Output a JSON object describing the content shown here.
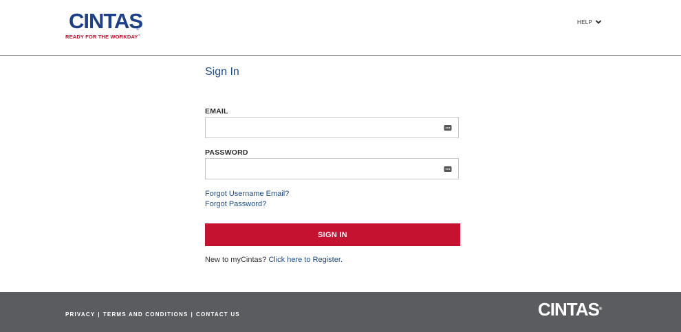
{
  "header": {
    "logo_word": "CINTAS",
    "logo_registered": "®",
    "logo_tagline": "READY FOR THE WORKDAY",
    "logo_tm": "™",
    "help_label": "HELP"
  },
  "main": {
    "title": "Sign In",
    "email_label": "EMAIL",
    "email_value": "",
    "password_label": "PASSWORD",
    "password_value": "",
    "forgot_email": "Forgot Username Email?",
    "forgot_password": "Forgot Password?",
    "sign_in_button": "SIGN IN",
    "register_text": "New to myCintas?",
    "register_link": "Click here to Register."
  },
  "footer": {
    "privacy": "PRIVACY",
    "terms": "TERMS AND CONDITIONS",
    "contact": "CONTACT US",
    "separator": "|",
    "logo_word": "CINTAS",
    "logo_registered": "®"
  },
  "colors": {
    "brand_blue": "#1e3f8a",
    "brand_red": "#c41230",
    "link_blue": "#1e4b85",
    "footer_gray": "#5a5c60"
  },
  "icons": {
    "help_toggle": "chevron-down-icon",
    "email_field": "password-manager-key-icon",
    "password_field": "password-manager-key-icon"
  }
}
